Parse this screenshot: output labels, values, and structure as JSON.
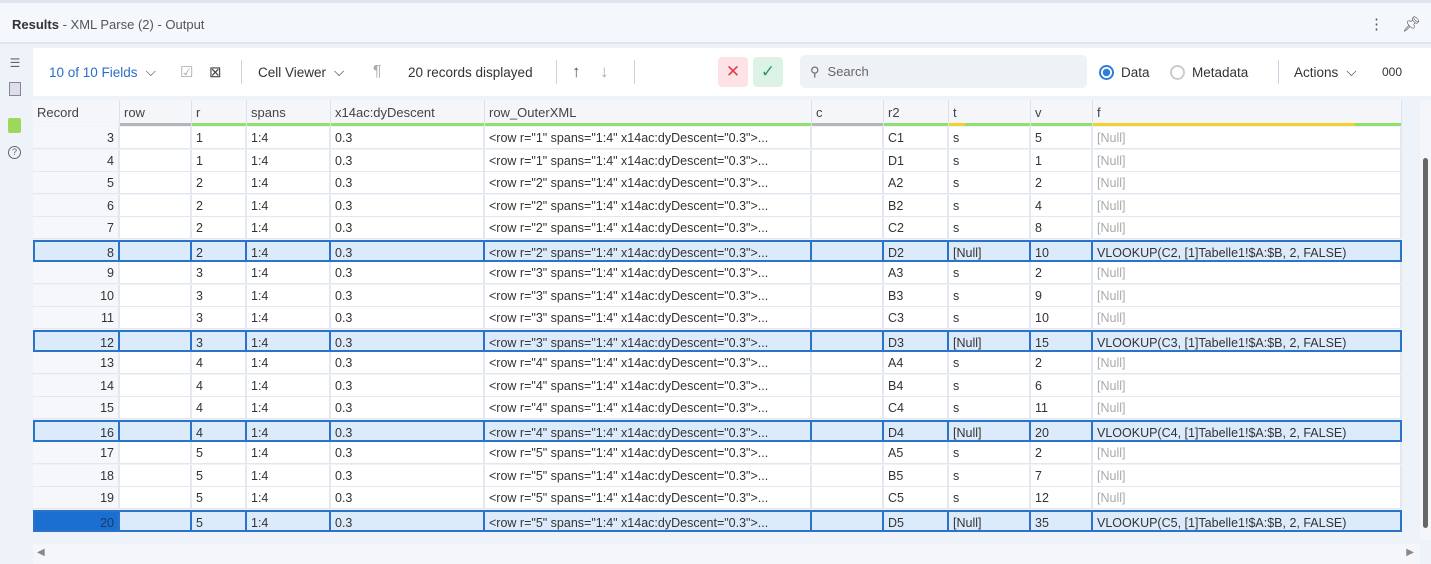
{
  "window": {
    "title_bold": "Results",
    "title_rest": " - XML Parse (2) - Output"
  },
  "toolbar": {
    "fields": "10 of 10 Fields",
    "cell_viewer": "Cell Viewer",
    "records": "20 records displayed",
    "search_placeholder": "Search",
    "data_label": "Data",
    "metadata_label": "Metadata",
    "actions": "Actions",
    "more": "000"
  },
  "colors": {
    "accent": "#2f7dd8",
    "green": "#90e070",
    "yellow": "#f5cf2a",
    "gray": "#b5b5b5"
  },
  "columns": [
    "Record",
    "row",
    "r",
    "spans",
    "x14ac:dyDescent",
    "row_OuterXML",
    "c",
    "r2",
    "t",
    "v",
    "f"
  ],
  "rows": [
    [
      "3",
      "",
      "1",
      "1:4",
      "0.3",
      "<row r=\"1\" spans=\"1:4\" x14ac:dyDescent=\"0.3\">...",
      "",
      "C1",
      "s",
      "5",
      "[Null]"
    ],
    [
      "4",
      "",
      "1",
      "1:4",
      "0.3",
      "<row r=\"1\" spans=\"1:4\" x14ac:dyDescent=\"0.3\">...",
      "",
      "D1",
      "s",
      "1",
      "[Null]"
    ],
    [
      "5",
      "",
      "2",
      "1:4",
      "0.3",
      "<row r=\"2\" spans=\"1:4\" x14ac:dyDescent=\"0.3\">...",
      "",
      "A2",
      "s",
      "2",
      "[Null]"
    ],
    [
      "6",
      "",
      "2",
      "1:4",
      "0.3",
      "<row r=\"2\" spans=\"1:4\" x14ac:dyDescent=\"0.3\">...",
      "",
      "B2",
      "s",
      "4",
      "[Null]"
    ],
    [
      "7",
      "",
      "2",
      "1:4",
      "0.3",
      "<row r=\"2\" spans=\"1:4\" x14ac:dyDescent=\"0.3\">...",
      "",
      "C2",
      "s",
      "8",
      "[Null]"
    ],
    [
      "8",
      "",
      "2",
      "1:4",
      "0.3",
      "<row r=\"2\" spans=\"1:4\" x14ac:dyDescent=\"0.3\">...",
      "",
      "D2",
      "[Null]",
      "10",
      "VLOOKUP(C2, [1]Tabelle1!$A:$B, 2, FALSE)"
    ],
    [
      "9",
      "",
      "3",
      "1:4",
      "0.3",
      "<row r=\"3\" spans=\"1:4\" x14ac:dyDescent=\"0.3\">...",
      "",
      "A3",
      "s",
      "2",
      "[Null]"
    ],
    [
      "10",
      "",
      "3",
      "1:4",
      "0.3",
      "<row r=\"3\" spans=\"1:4\" x14ac:dyDescent=\"0.3\">...",
      "",
      "B3",
      "s",
      "9",
      "[Null]"
    ],
    [
      "11",
      "",
      "3",
      "1:4",
      "0.3",
      "<row r=\"3\" spans=\"1:4\" x14ac:dyDescent=\"0.3\">...",
      "",
      "C3",
      "s",
      "10",
      "[Null]"
    ],
    [
      "12",
      "",
      "3",
      "1:4",
      "0.3",
      "<row r=\"3\" spans=\"1:4\" x14ac:dyDescent=\"0.3\">...",
      "",
      "D3",
      "[Null]",
      "15",
      "VLOOKUP(C3, [1]Tabelle1!$A:$B, 2, FALSE)"
    ],
    [
      "13",
      "",
      "4",
      "1:4",
      "0.3",
      "<row r=\"4\" spans=\"1:4\" x14ac:dyDescent=\"0.3\">...",
      "",
      "A4",
      "s",
      "2",
      "[Null]"
    ],
    [
      "14",
      "",
      "4",
      "1:4",
      "0.3",
      "<row r=\"4\" spans=\"1:4\" x14ac:dyDescent=\"0.3\">...",
      "",
      "B4",
      "s",
      "6",
      "[Null]"
    ],
    [
      "15",
      "",
      "4",
      "1:4",
      "0.3",
      "<row r=\"4\" spans=\"1:4\" x14ac:dyDescent=\"0.3\">...",
      "",
      "C4",
      "s",
      "11",
      "[Null]"
    ],
    [
      "16",
      "",
      "4",
      "1:4",
      "0.3",
      "<row r=\"4\" spans=\"1:4\" x14ac:dyDescent=\"0.3\">...",
      "",
      "D4",
      "[Null]",
      "20",
      "VLOOKUP(C4, [1]Tabelle1!$A:$B, 2, FALSE)"
    ],
    [
      "17",
      "",
      "5",
      "1:4",
      "0.3",
      "<row r=\"5\" spans=\"1:4\" x14ac:dyDescent=\"0.3\">...",
      "",
      "A5",
      "s",
      "2",
      "[Null]"
    ],
    [
      "18",
      "",
      "5",
      "1:4",
      "0.3",
      "<row r=\"5\" spans=\"1:4\" x14ac:dyDescent=\"0.3\">...",
      "",
      "B5",
      "s",
      "7",
      "[Null]"
    ],
    [
      "19",
      "",
      "5",
      "1:4",
      "0.3",
      "<row r=\"5\" spans=\"1:4\" x14ac:dyDescent=\"0.3\">...",
      "",
      "C5",
      "s",
      "12",
      "[Null]"
    ],
    [
      "20",
      "",
      "5",
      "1:4",
      "0.3",
      "<row r=\"5\" spans=\"1:4\" x14ac:dyDescent=\"0.3\">...",
      "",
      "D5",
      "[Null]",
      "35",
      "VLOOKUP(C5, [1]Tabelle1!$A:$B, 2, FALSE)"
    ]
  ],
  "selected_records": [
    "8",
    "12",
    "16",
    "20"
  ],
  "current_record": "20"
}
